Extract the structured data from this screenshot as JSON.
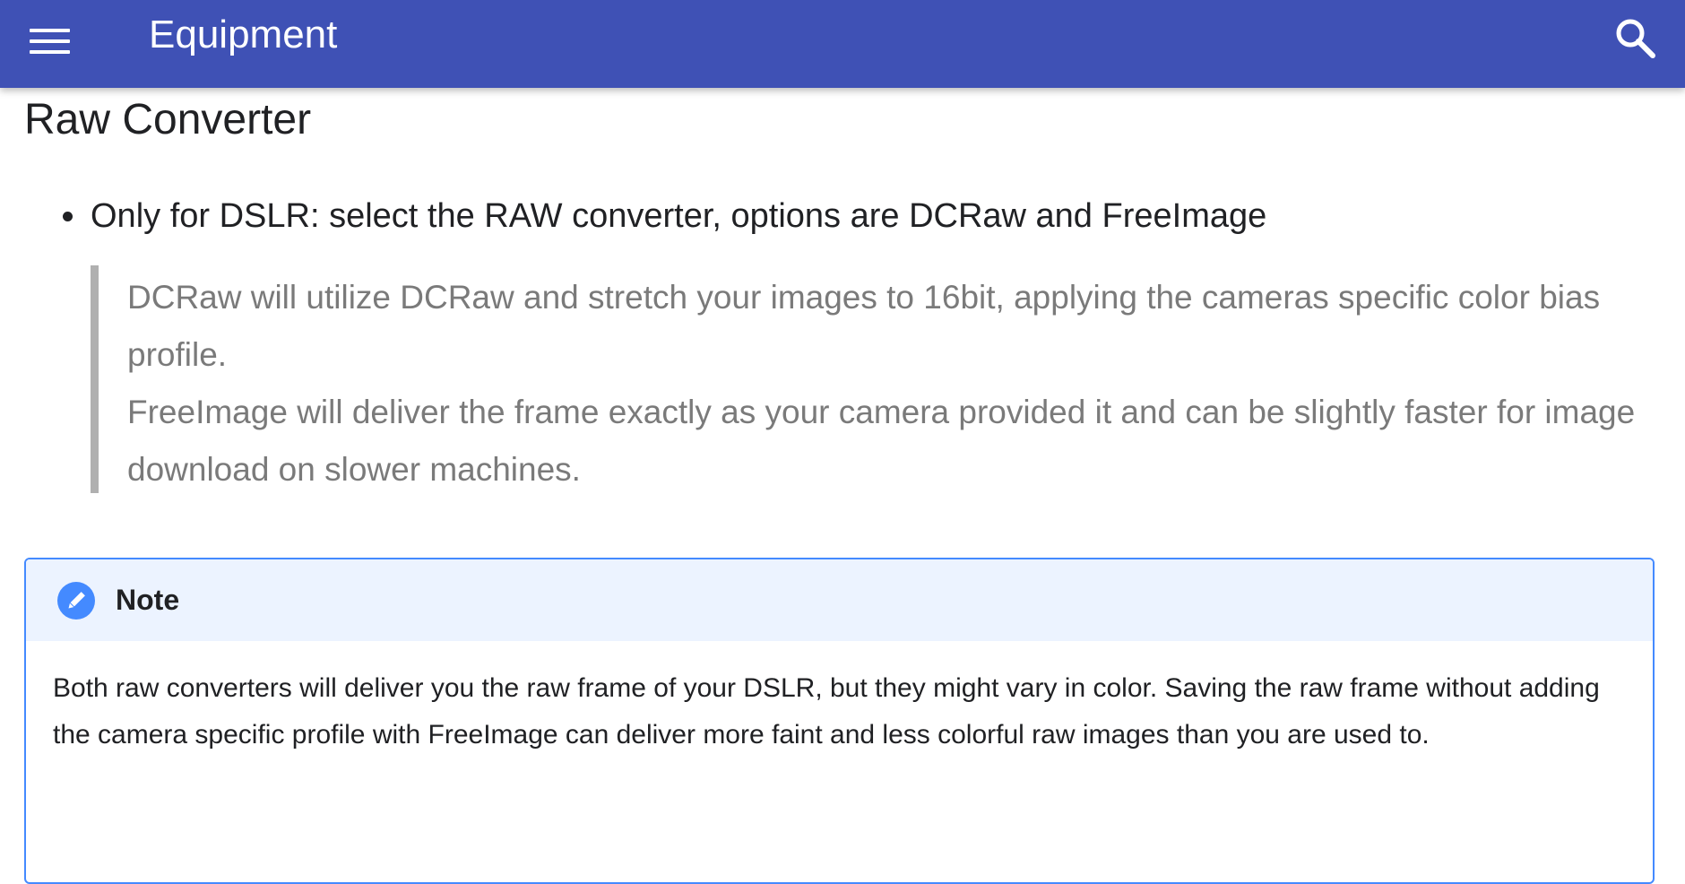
{
  "appbar": {
    "title": "Equipment",
    "background": "#3f51b5",
    "menu_icon": "menu-icon",
    "search_icon": "search-icon"
  },
  "section": {
    "title": "Raw Converter",
    "bullet": "Only for DSLR: select the RAW converter, options are DCRaw and FreeImage",
    "quote": [
      "DCRaw will utilize DCRaw and stretch your images to 16bit, applying the cameras specific color bias profile.",
      "FreeImage will deliver the frame exactly as your camera provided it and can be slightly faster for image download on slower machines."
    ]
  },
  "note": {
    "title": "Note",
    "icon": "pencil-icon",
    "accent": "#448aff",
    "body": "Both raw converters will deliver you the raw frame of your DSLR, but they might vary in color. Saving the raw frame without adding the camera specific profile with FreeImage can deliver more faint and less colorful raw images than you are used to."
  }
}
